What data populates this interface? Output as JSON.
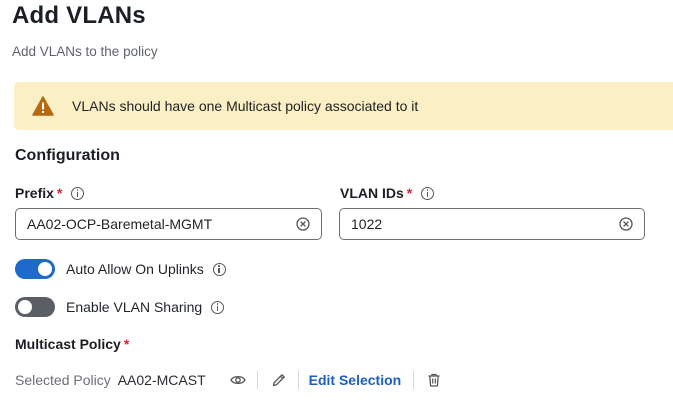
{
  "page": {
    "title": "Add VLANs",
    "subtitle": "Add VLANs to the policy"
  },
  "banner": {
    "message": "VLANs should have one Multicast policy associated to it",
    "icon": "warning-icon",
    "color": "#fbefc6"
  },
  "configuration": {
    "section_title": "Configuration",
    "prefix": {
      "label": "Prefix",
      "required": "*",
      "value": "AA02-OCP-Baremetal-MGMT"
    },
    "vlan_ids": {
      "label": "VLAN IDs",
      "required": "*",
      "value": "1022"
    },
    "auto_allow": {
      "label": "Auto Allow On Uplinks",
      "enabled": true
    },
    "vlan_sharing": {
      "label": "Enable VLAN Sharing",
      "enabled": false
    },
    "multicast_policy": {
      "label": "Multicast Policy",
      "required": "*",
      "selected_key": "Selected Policy",
      "selected_value": "AA02-MCAST",
      "edit_label": "Edit Selection"
    }
  },
  "colors": {
    "accent": "#1d69cc",
    "link": "#1d5fbf",
    "required": "#d0263a"
  }
}
